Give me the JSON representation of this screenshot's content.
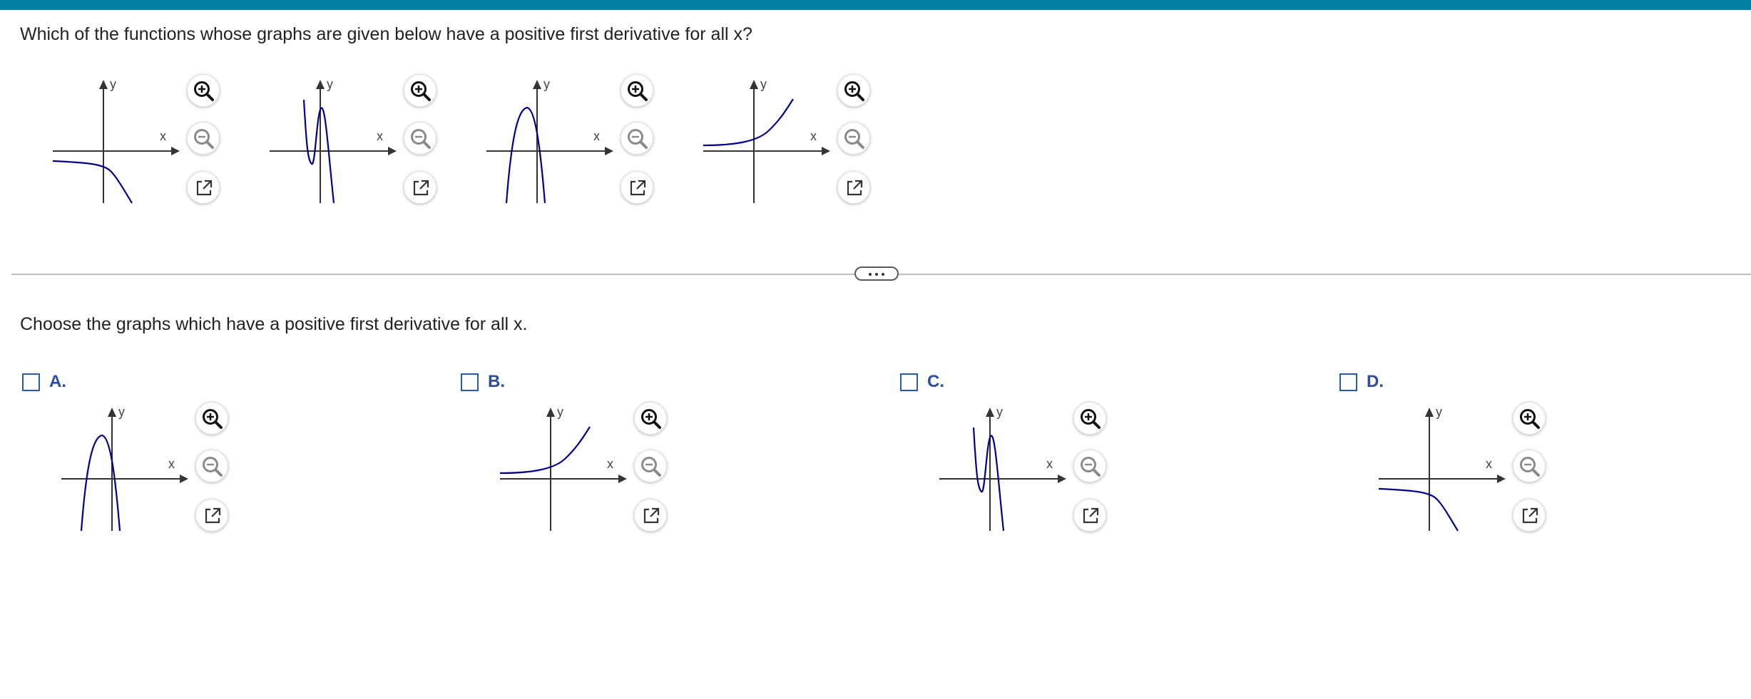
{
  "question": {
    "text": "Which of the functions whose graphs are given below have a positive first derivative for all x?"
  },
  "prompt": {
    "text": "Choose the graphs which have a positive first derivative for all x."
  },
  "axis_labels": {
    "x": "x",
    "y": "y"
  },
  "colors": {
    "curve": "#00008b",
    "axis": "#333333",
    "accent": "#037fa3",
    "option_letter": "#2f4d9a"
  },
  "graph_tools": {
    "zoom_in": "zoom-in-icon",
    "zoom_out": "zoom-out-icon",
    "open_new_window": "external-link-icon"
  },
  "given_graphs": [
    {
      "shape": "decreasing-negative"
    },
    {
      "shape": "cubic-wiggle"
    },
    {
      "shape": "downward-parabola"
    },
    {
      "shape": "exponential-growth"
    }
  ],
  "options": [
    {
      "letter": "A.",
      "shape": "downward-parabola",
      "checked": false
    },
    {
      "letter": "B.",
      "shape": "exponential-growth",
      "checked": false
    },
    {
      "letter": "C.",
      "shape": "cubic-wiggle",
      "checked": false
    },
    {
      "letter": "D.",
      "shape": "decreasing-negative",
      "checked": false
    }
  ]
}
